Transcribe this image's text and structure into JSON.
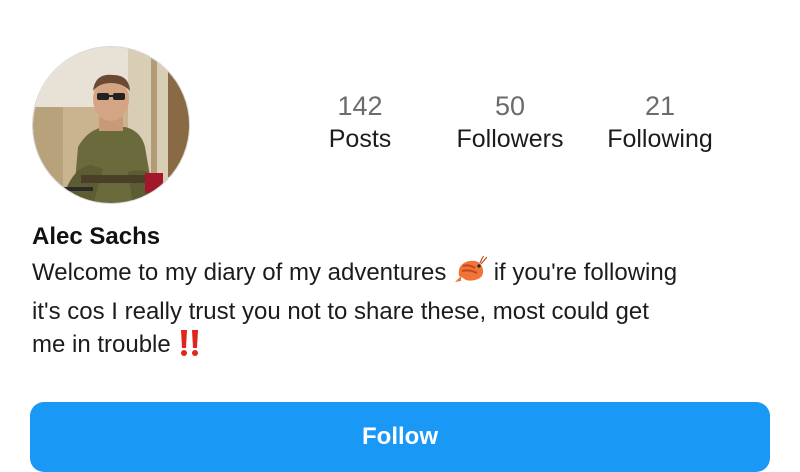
{
  "profile": {
    "name": "Alec Sachs",
    "avatar_icon": "profile-photo",
    "stats": {
      "posts_value": "142",
      "posts_label": "Posts",
      "followers_value": "50",
      "followers_label": "Followers",
      "following_value": "21",
      "following_label": "Following"
    },
    "bio": {
      "line1_a": "Welcome to my diary of my adventures ",
      "line1_b": " if you're following",
      "line2": "it's cos I really trust you not to share these, most could get",
      "line3": "me in trouble ",
      "emoji1": "shrimp-emoji",
      "emoji2": "double-exclamation-emoji"
    },
    "follow_label": "Follow"
  },
  "colors": {
    "follow_button": "#1a98f5",
    "stat_value": "#6b6b6b",
    "text": "#1c1c1c",
    "exclamation": "#e0261c",
    "shrimp": "#f0733a"
  }
}
